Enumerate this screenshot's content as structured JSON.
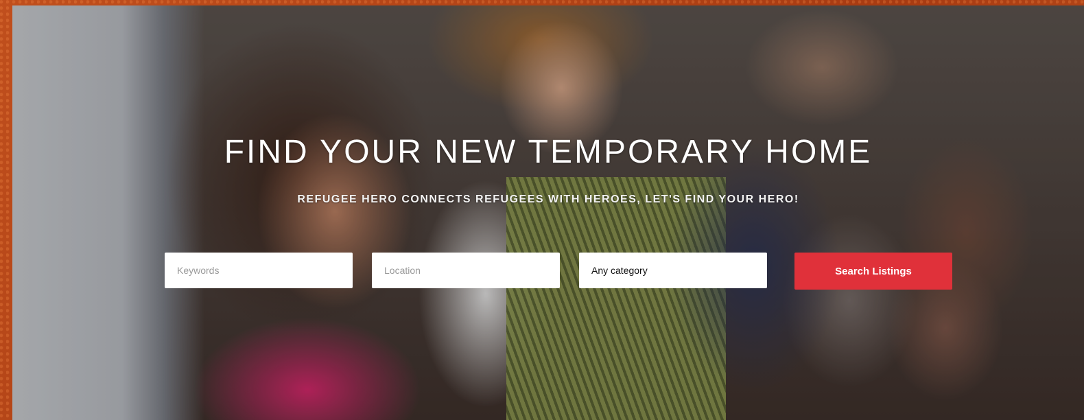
{
  "hero": {
    "headline": "FIND YOUR NEW TEMPORARY HOME",
    "subheadline": "REFUGEE HERO CONNECTS REFUGEES WITH HEROES, LET'S FIND YOUR HERO!"
  },
  "search": {
    "keywords_placeholder": "Keywords",
    "keywords_value": "",
    "location_placeholder": "Location",
    "location_value": "",
    "category_selected": "Any category",
    "button_label": "Search Listings"
  },
  "colors": {
    "accent": "#e0313a",
    "frame": "#b8471a"
  }
}
